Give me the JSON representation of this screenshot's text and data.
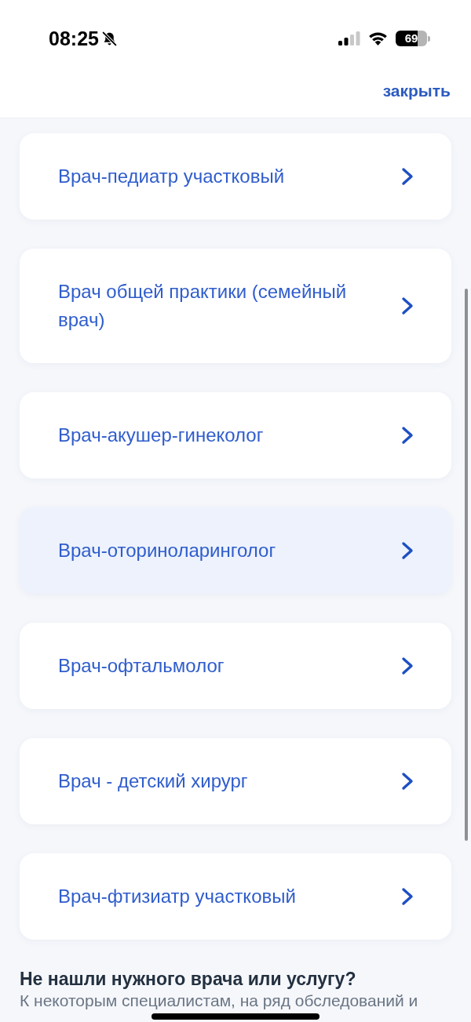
{
  "status_bar": {
    "time": "08:25",
    "battery": "69"
  },
  "header": {
    "close_link": "закрыть"
  },
  "specialists": [
    {
      "label": "Врач-педиатр участковый",
      "selected": false
    },
    {
      "label": "Врач общей практики (семейный врач)",
      "selected": false
    },
    {
      "label": "Врач-акушер-гинеколог",
      "selected": false
    },
    {
      "label": "Врач-оториноларинголог",
      "selected": true
    },
    {
      "label": "Врач-офтальмолог",
      "selected": false
    },
    {
      "label": "Врач - детский хирург",
      "selected": false
    },
    {
      "label": "Врач-фтизиатр участковый",
      "selected": false
    }
  ],
  "help": {
    "title": "Не нашли нужного врача или услугу?",
    "text": "К некоторым специалистам, на ряд обследований и"
  }
}
